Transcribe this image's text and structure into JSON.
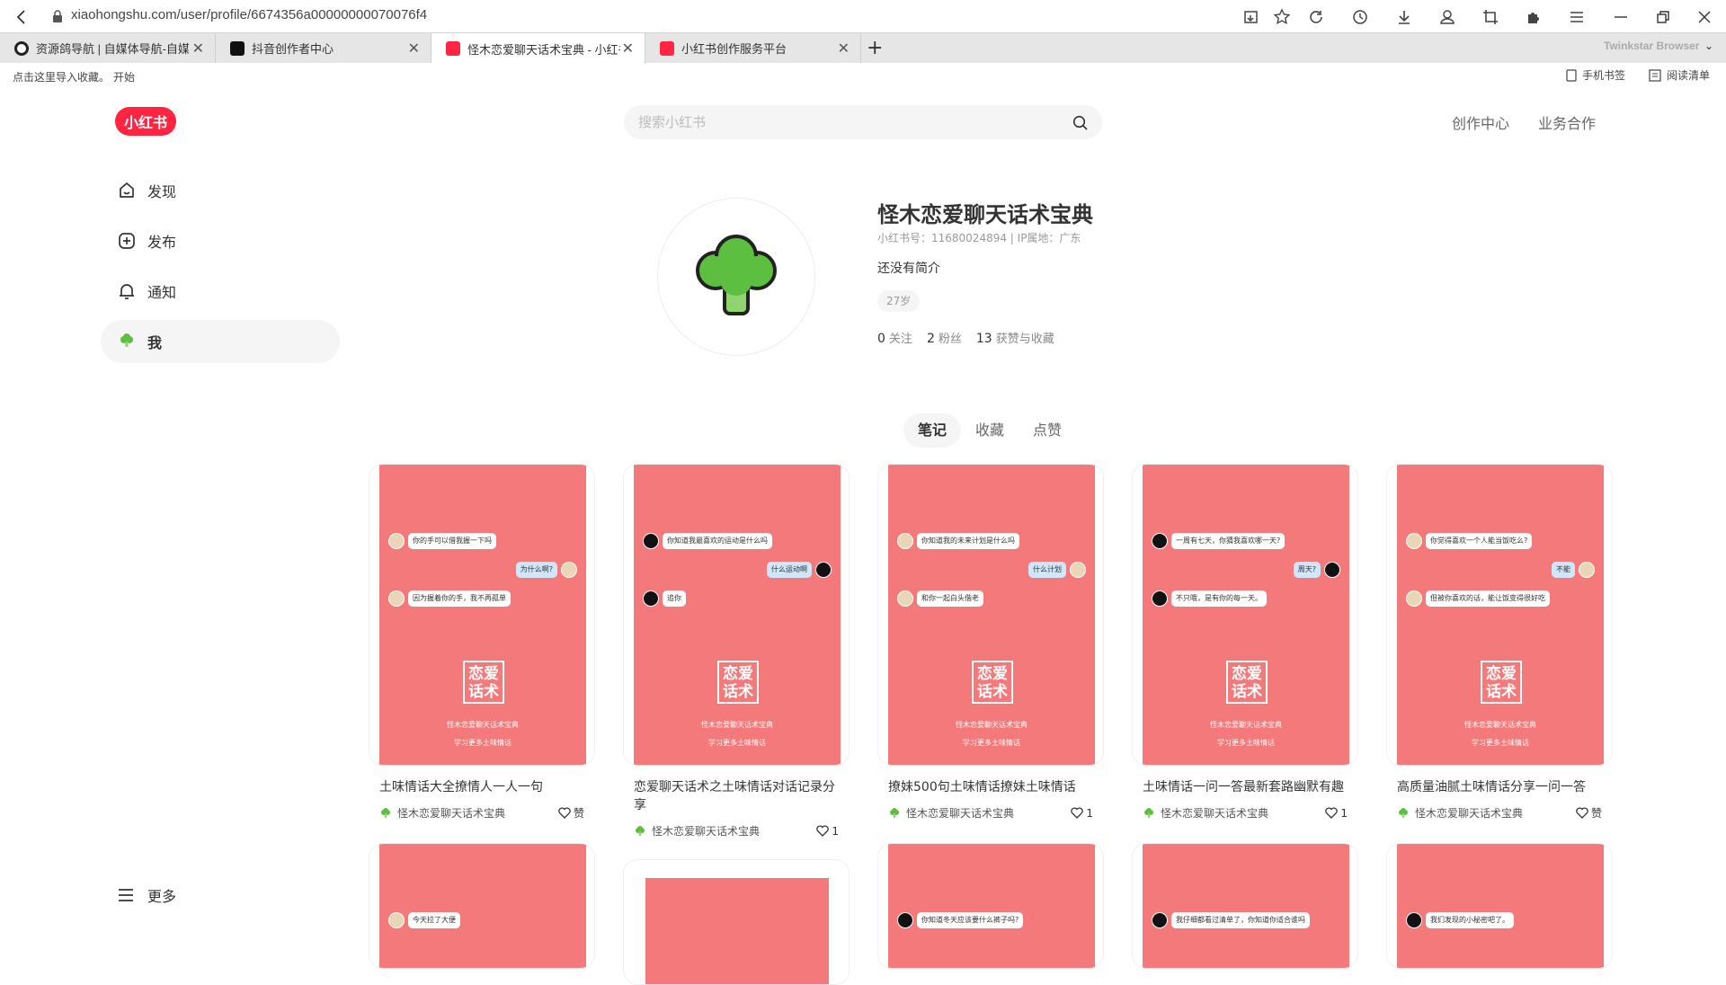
{
  "browser": {
    "url": "xiaohongshu.com/user/profile/6674356a00000000070076f4",
    "tabs": [
      {
        "label": "资源鸽导航 | 自媒体导航-自媒",
        "fav": "#222"
      },
      {
        "label": "抖音创作者中心",
        "fav": "#111"
      },
      {
        "label": "怪木恋爱聊天话术宝典 - 小红书",
        "fav": "#ff2442"
      },
      {
        "label": "小红书创作服务平台",
        "fav": "#ff2442"
      }
    ],
    "brand": "Twinkstar Browser",
    "bookmark_hint": "点击这里导入收藏。",
    "bookmark_start": "开始",
    "mobile_bookmarks": "手机书签",
    "reading_list": "阅读清单"
  },
  "site": {
    "logo": "小红书",
    "search_placeholder": "搜索小红书",
    "nav_creator": "创作中心",
    "nav_business": "业务合作"
  },
  "sidebar": {
    "items": [
      {
        "label": "发现",
        "icon": "discover-icon"
      },
      {
        "label": "发布",
        "icon": "publish-icon"
      },
      {
        "label": "通知",
        "icon": "bell-icon"
      },
      {
        "label": "我",
        "icon": "me-avatar-icon"
      }
    ],
    "more": "更多"
  },
  "profile": {
    "name": "怪木恋爱聊天话术宝典",
    "id_line": "小红书号：11680024894 | IP属地：广东",
    "bio": "还没有简介",
    "age": "27岁",
    "following": "0",
    "following_label": "关注",
    "followers": "2",
    "followers_label": "粉丝",
    "likes": "13",
    "likes_label": "获赞与收藏"
  },
  "content_tabs": [
    "笔记",
    "收藏",
    "点赞"
  ],
  "cover_text": {
    "stamp1": "恋爱",
    "stamp2": "话术",
    "line1": "怪木恋爱聊天话术宝典",
    "line2": "学习更多土味情话"
  },
  "notes": [
    {
      "title": "土味情话大全撩情人一人一句",
      "author": "怪木恋爱聊天话术宝典",
      "likes": "赞",
      "bubbles": [
        "你的手可以借我握一下吗",
        "为什么啊?",
        "因为握着你的手，我不再孤单"
      ],
      "dark": false
    },
    {
      "title": "恋爱聊天话术之土味情话对话记录分享",
      "author": "怪木恋爱聊天话术宝典",
      "likes": "1",
      "bubbles": [
        "你知道我最喜欢的运动是什么吗",
        "什么运动啊",
        "追你"
      ],
      "dark": true
    },
    {
      "title": "撩妹500句土味情话撩妹土味情话",
      "author": "怪木恋爱聊天话术宝典",
      "likes": "1",
      "bubbles": [
        "你知道我的未来计划是什么吗",
        "什么计划",
        "和你一起白头偕老"
      ],
      "dark": false
    },
    {
      "title": "土味情话一问一答最新套路幽默有趣",
      "author": "怪木恋爱聊天话术宝典",
      "likes": "1",
      "bubbles": [
        "一周有七天，你猜我喜欢哪一天?",
        "周天?",
        "不只哦，是有你的每一天。"
      ],
      "dark": true
    },
    {
      "title": "高质量油腻土味情话分享一问一答",
      "author": "怪木恋爱聊天话术宝典",
      "likes": "赞",
      "bubbles": [
        "你觉得喜欢一个人能当饭吃么?",
        "不能",
        "但被你喜欢的话，能让饭变得很好吃"
      ],
      "dark": false
    }
  ],
  "notes_row2": [
    {
      "bubble": "今天拉了大便",
      "dark": false
    },
    {
      "bubble": "",
      "dark": true
    },
    {
      "bubble": "你知道冬天应该要什么裤子吗?",
      "dark": true
    },
    {
      "bubble": "我仔细都看过清单了，你知道你适合谁吗",
      "dark": true
    },
    {
      "bubble": "我们发现的小秘密吧了。",
      "dark": true
    }
  ],
  "colors": {
    "brand": "#ff2442",
    "cover": "#f3797b"
  }
}
